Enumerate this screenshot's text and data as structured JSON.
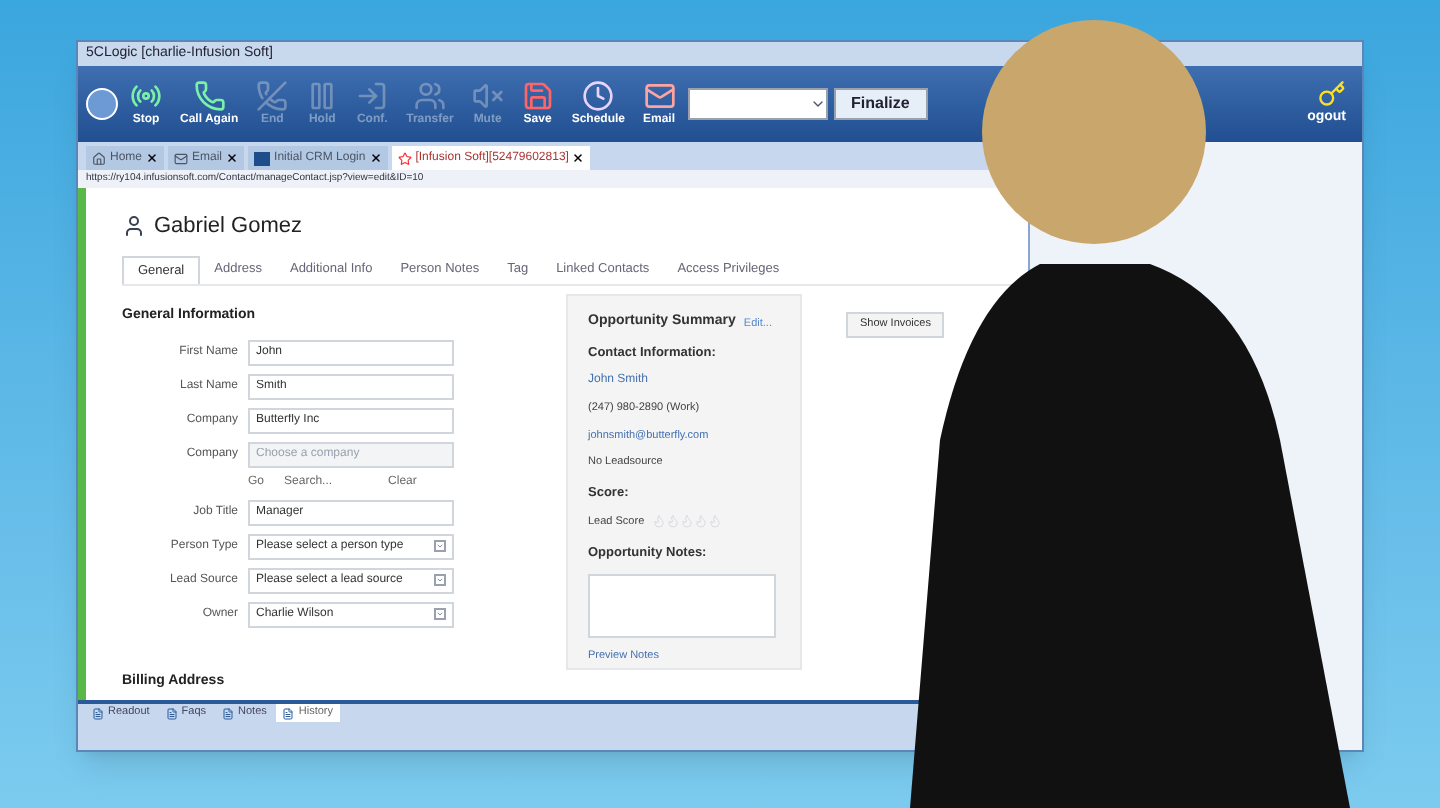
{
  "window": {
    "title": "5CLogic [charlie-Infusion Soft]"
  },
  "toolbar": [
    {
      "label": "Stop",
      "kind": "stop",
      "disabled": false
    },
    {
      "label": "Call Again",
      "kind": "call",
      "disabled": false
    },
    {
      "label": "End",
      "kind": "end",
      "disabled": true
    },
    {
      "label": "Hold",
      "kind": "hold",
      "disabled": true
    },
    {
      "label": "Conf.",
      "kind": "conf",
      "disabled": true
    },
    {
      "label": "Transfer",
      "kind": "transfer",
      "disabled": true
    },
    {
      "label": "Mute",
      "kind": "mute",
      "disabled": true
    },
    {
      "label": "Save",
      "kind": "save",
      "disabled": false
    },
    {
      "label": "Schedule",
      "kind": "schedule",
      "disabled": false
    },
    {
      "label": "Email",
      "kind": "email",
      "disabled": false
    }
  ],
  "finalize_button": "Finalize",
  "logout_label": "ogout",
  "browser_tabs": [
    {
      "label": "Home",
      "kind": "home",
      "selected": false
    },
    {
      "label": "Email",
      "kind": "email",
      "selected": false
    },
    {
      "label": "Initial CRM Login",
      "kind": "logo",
      "selected": false
    },
    {
      "label": "[Infusion Soft][52479602813]",
      "kind": "star",
      "selected": true
    }
  ],
  "url": "https://ry104.infusionsoft.com/Contact/manageContact.jsp?view=edit&ID=10",
  "contact_name": "Gabriel Gomez",
  "tabs": [
    {
      "label": "General",
      "selected": true
    },
    {
      "label": "Address",
      "selected": false
    },
    {
      "label": "Additional Info",
      "selected": false
    },
    {
      "label": "Person Notes",
      "selected": false
    },
    {
      "label": "Tag",
      "selected": false
    },
    {
      "label": "Linked Contacts",
      "selected": false
    },
    {
      "label": "Access Privileges",
      "selected": false
    }
  ],
  "general_information": {
    "title": "General Information",
    "fields": [
      {
        "label": "First Name",
        "kind": "text",
        "value": "John"
      },
      {
        "label": "Last Name",
        "kind": "text",
        "value": "Smith"
      },
      {
        "label": "Company",
        "kind": "text",
        "value": "Butterfly Inc"
      },
      {
        "label": "Company",
        "kind": "lookup",
        "placeholder": "Choose a company",
        "links": [
          "Go",
          "Search...",
          "Clear"
        ]
      },
      {
        "label": "Job Title",
        "kind": "text",
        "value": "Manager"
      },
      {
        "label": "Person Type",
        "kind": "select",
        "value": "Please select a person type"
      },
      {
        "label": "Lead Source",
        "kind": "select",
        "value": "Please select a lead source"
      },
      {
        "label": "Owner",
        "kind": "select",
        "value": "Charlie Wilson"
      }
    ]
  },
  "billing_address_title": "Billing Address",
  "opportunity_summary": {
    "title": "Opportunity Summary",
    "edit_link": "Edit...",
    "contact_heading": "Contact Information:",
    "contact_name": "John Smith",
    "phone": "(247) 980-2890 (Work)",
    "email": "johnsmith@butterfly.com",
    "lead_source": "No Leadsource",
    "score_heading": "Score:",
    "score_label": "Lead Score",
    "stars": 0,
    "notes_heading": "Opportunity Notes:",
    "preview_link": "Preview Notes"
  },
  "show_invoices_button": "Show Invoices",
  "bottom_tabs": [
    {
      "label": "Readout",
      "selected": false
    },
    {
      "label": "Faqs",
      "selected": false
    },
    {
      "label": "Notes",
      "selected": false
    },
    {
      "label": "History",
      "selected": true
    }
  ]
}
